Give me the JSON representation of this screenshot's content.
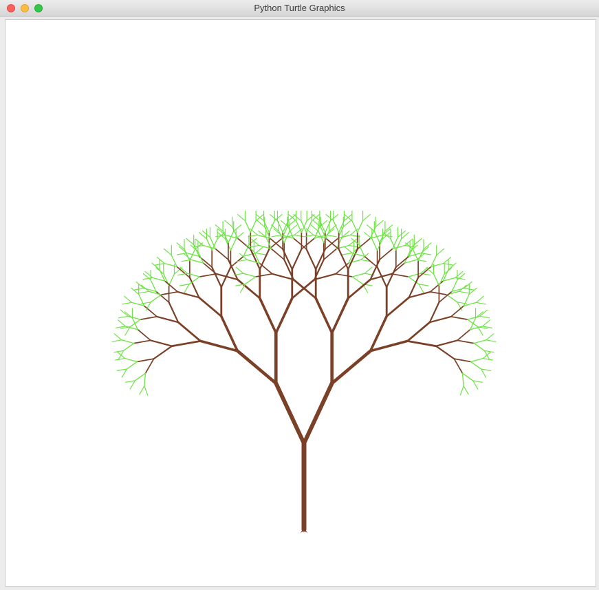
{
  "window": {
    "title": "Python Turtle Graphics"
  },
  "canvas": {
    "background": "#ffffff",
    "trunk_color": "#7b4128",
    "leaf_color": "#6ee346",
    "turtle_cursor_icon": "turtle-arrow-icon"
  },
  "tree": {
    "depth": 8,
    "trunk_length": 125,
    "trunk_width": 7,
    "branch_angle_deg": 25,
    "length_ratio": 0.76
  }
}
